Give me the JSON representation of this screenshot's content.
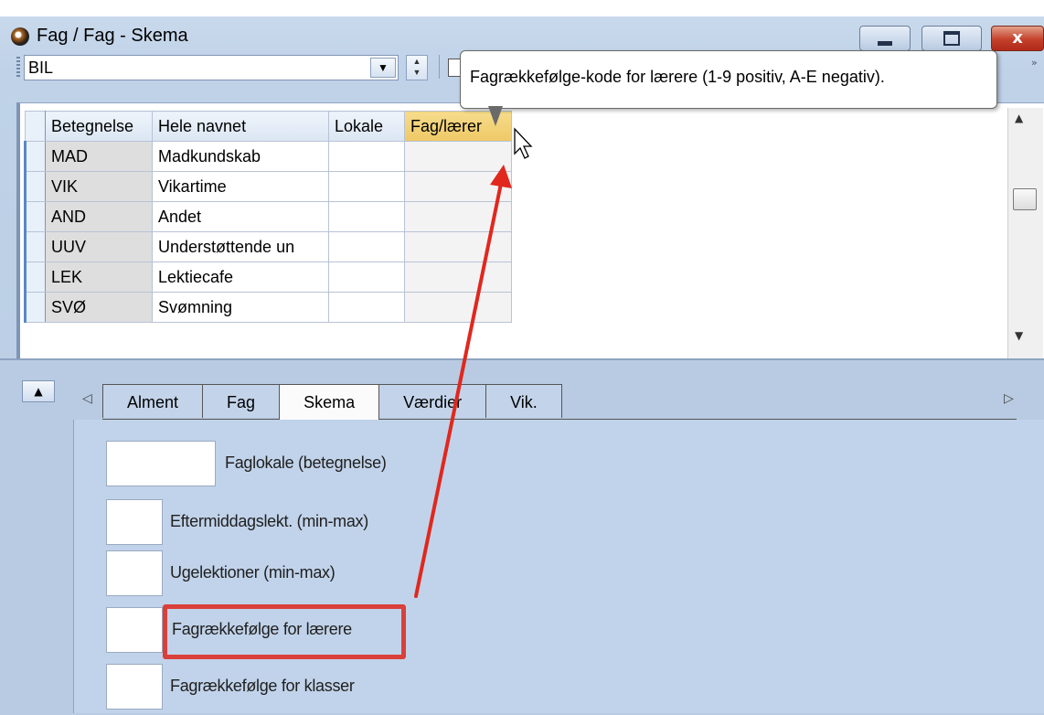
{
  "window": {
    "title": "Fag / Fag - Skema",
    "close_glyph": "x",
    "icons": [
      "app-clock-icon",
      "minimize-icon",
      "maximize-icon",
      "close-icon"
    ]
  },
  "toolbar": {
    "combo_value": "BIL",
    "combo_arrow": "▼",
    "spin_up": "▲",
    "spin_down": "▼",
    "overflow": "»"
  },
  "tooltip": {
    "text": "Fagrækkefølge-kode for lærere (1-9 positiv, A-E negativ)."
  },
  "grid": {
    "columns": [
      "Betegnelse",
      "Hele navnet",
      "Lokale",
      "Fag/lærer"
    ],
    "active_column": "Fag/lærer",
    "rows": [
      {
        "code": "MAD",
        "name": "Madkundskab",
        "lokale": "",
        "faglaerer": ""
      },
      {
        "code": "VIK",
        "name": "Vikartime",
        "lokale": "",
        "faglaerer": ""
      },
      {
        "code": "AND",
        "name": "Andet",
        "lokale": "",
        "faglaerer": ""
      },
      {
        "code": "UUV",
        "name": "Understøttende un",
        "lokale": "",
        "faglaerer": ""
      },
      {
        "code": "LEK",
        "name": "Lektiecafe",
        "lokale": "",
        "faglaerer": ""
      },
      {
        "code": "SVØ",
        "name": "Svømning",
        "lokale": "",
        "faglaerer": ""
      }
    ],
    "scroll_up": "▲",
    "scroll_down": "▼"
  },
  "panel": {
    "collapse_glyph": "▲",
    "tab_left": "◁",
    "tab_right": "▷",
    "tabs": [
      "Alment",
      "Fag",
      "Skema",
      "Værdier",
      "Vik."
    ],
    "active_tab": "Skema",
    "fields": [
      {
        "label": "Faglokale (betegnelse)",
        "value": ""
      },
      {
        "label": "Eftermiddagslekt. (min-max)",
        "value": ""
      },
      {
        "label": "Ugelektioner (min-max)",
        "value": ""
      },
      {
        "label": "Fagrækkefølge for lærere",
        "value": ""
      },
      {
        "label": "Fagrækkefølge for klasser",
        "value": ""
      }
    ]
  },
  "annotation": {
    "highlight_color": "#d9403a",
    "arrow_color": "#e0281e"
  }
}
